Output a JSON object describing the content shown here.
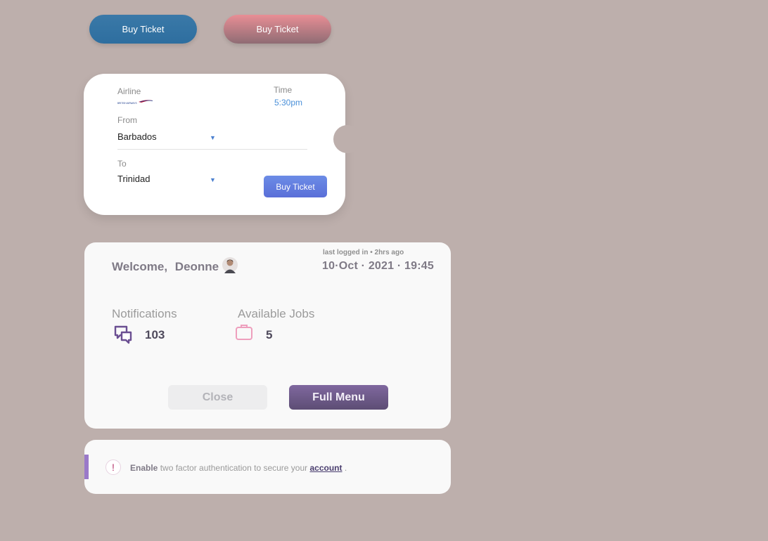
{
  "top_buttons": {
    "buy_blue": "Buy Ticket",
    "buy_pink": "Buy Ticket"
  },
  "ticket": {
    "airline_label": "Airline",
    "airline_logo": "BRITISH AIRWAYS",
    "time_label": "Time",
    "time_value": "5:30pm",
    "from_label": "From",
    "from_value": "Barbados",
    "to_label": "To",
    "to_value": "Trinidad",
    "buy_label": "Buy Ticket"
  },
  "welcome": {
    "greeting": "Welcome,",
    "name": "Deonne",
    "last_login": "last logged in • 2hrs ago",
    "datetime": "10·Oct · 2021 · 19:45",
    "notifications_label": "Notifications",
    "notifications_count": "103",
    "jobs_label": "Available Jobs",
    "jobs_count": "5",
    "close_label": "Close",
    "full_menu_label": "Full Menu"
  },
  "alert": {
    "icon": "!",
    "enable": "Enable",
    "text": "two factor authentication to secure your",
    "link": "account",
    "end": "."
  },
  "colors": {
    "background": "#bdafac",
    "blue_button": "#2e6e9f",
    "pink_button": "#e88e95",
    "accent_purple": "#9a79c9",
    "full_menu": "#6a5785"
  }
}
